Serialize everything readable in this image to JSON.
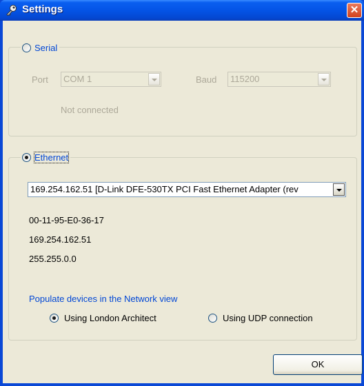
{
  "window": {
    "title": "Settings",
    "close_label": "✕"
  },
  "serial": {
    "legend": "Serial",
    "port_label": "Port",
    "port_value": "COM 1",
    "baud_label": "Baud",
    "baud_value": "115200",
    "status": "Not connected"
  },
  "ethernet": {
    "legend": "Ethernet",
    "adapter": "169.254.162.51 [D-Link DFE-530TX PCI Fast Ethernet Adapter (rev",
    "mac": "00-11-95-E0-36-17",
    "ip": "169.254.162.51",
    "mask": "255.255.0.0",
    "populate_label": "Populate devices in the Network view",
    "option_london": "Using London Architect",
    "option_udp": "Using UDP connection"
  },
  "buttons": {
    "ok": "OK"
  },
  "colors": {
    "titlebar": "#0454e6",
    "link": "#0046d5",
    "face": "#ece9d8"
  }
}
